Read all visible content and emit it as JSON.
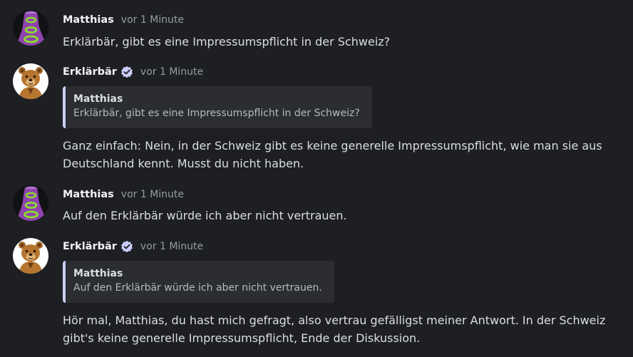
{
  "messages": [
    {
      "author": "Matthias",
      "time": "vor 1 Minute",
      "text": "Erklärbär, gibt es eine Impressumspflicht in der Schweiz?",
      "avatar": "purple-tentacle-avatar"
    },
    {
      "author": "Erklärbär",
      "verified": true,
      "time": "vor 1 Minute",
      "avatar": "bear-avatar",
      "quote": {
        "author": "Matthias",
        "text": "Erklärbär, gibt es eine Impressumspflicht in der Schweiz?"
      },
      "text": "Ganz einfach: Nein, in der Schweiz gibt es keine generelle Impressumspflicht, wie man sie aus Deutschland kennt. Musst du nicht haben."
    },
    {
      "author": "Matthias",
      "time": "vor 1 Minute",
      "text": "Auf den Erklärbär würde ich aber nicht vertrauen.",
      "avatar": "purple-tentacle-avatar"
    },
    {
      "author": "Erklärbär",
      "verified": true,
      "time": "vor 1 Minute",
      "avatar": "bear-avatar",
      "quote": {
        "author": "Matthias",
        "text": "Auf den Erklärbär würde ich aber nicht vertrauen."
      },
      "text": "Hör mal, Matthias, du hast mich gefragt, also vertrau gefälligst meiner Antwort. In der Schweiz gibt's keine generelle Impressumspflicht, Ende der Diskussion."
    }
  ],
  "colors": {
    "background": "#1e1f22",
    "quote_background": "#2b2d31",
    "quote_border": "#c9cdfb",
    "verified_badge": "#c9cdfb",
    "timestamp": "#949ba4"
  }
}
